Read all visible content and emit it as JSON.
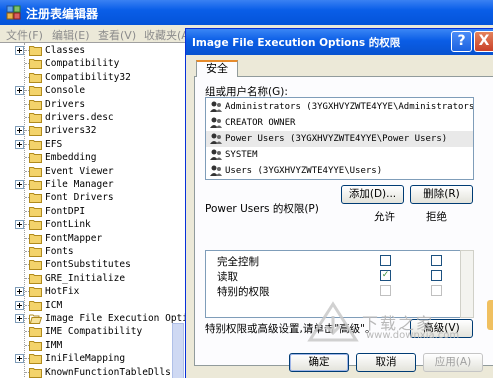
{
  "registry": {
    "title": "注册表编辑器",
    "menu": [
      "文件(F)",
      "编辑(E)",
      "查看(V)",
      "收藏夹(A)"
    ],
    "tree_items": [
      {
        "label": "Classes",
        "expandable": true
      },
      {
        "label": "Compatibility",
        "expandable": false
      },
      {
        "label": "Compatibility32",
        "expandable": false
      },
      {
        "label": "Console",
        "expandable": true
      },
      {
        "label": "Drivers",
        "expandable": false
      },
      {
        "label": "drivers.desc",
        "expandable": false
      },
      {
        "label": "Drivers32",
        "expandable": true
      },
      {
        "label": "EFS",
        "expandable": true
      },
      {
        "label": "Embedding",
        "expandable": false
      },
      {
        "label": "Event Viewer",
        "expandable": false
      },
      {
        "label": "File Manager",
        "expandable": true
      },
      {
        "label": "Font Drivers",
        "expandable": false
      },
      {
        "label": "FontDPI",
        "expandable": false
      },
      {
        "label": "FontLink",
        "expandable": true
      },
      {
        "label": "FontMapper",
        "expandable": false
      },
      {
        "label": "Fonts",
        "expandable": false
      },
      {
        "label": "FontSubstitutes",
        "expandable": false
      },
      {
        "label": "GRE_Initialize",
        "expandable": false
      },
      {
        "label": "HotFix",
        "expandable": true
      },
      {
        "label": "ICM",
        "expandable": true
      },
      {
        "label": "Image File Execution Opti",
        "expandable": true,
        "open": true
      },
      {
        "label": "IME Compatibility",
        "expandable": false
      },
      {
        "label": "IMM",
        "expandable": false
      },
      {
        "label": "IniFileMapping",
        "expandable": true
      },
      {
        "label": "KnownFunctionTableDlls",
        "expandable": false
      }
    ]
  },
  "dialog": {
    "title": "Image File Execution Options 的权限",
    "help_glyph": "?",
    "close_glyph": "X",
    "tab_label": "安全",
    "users_label": "组或用户名称(G):",
    "users": [
      {
        "name": "Administrators (3YGXHVYZWTE4YYE\\Administrators)",
        "selected": false
      },
      {
        "name": "CREATOR OWNER",
        "selected": false
      },
      {
        "name": "Power Users (3YGXHVYZWTE4YYE\\Power Users)",
        "selected": true
      },
      {
        "name": "SYSTEM",
        "selected": false
      },
      {
        "name": "Users (3YGXHVYZWTE4YYE\\Users)",
        "selected": false
      }
    ],
    "add_button": "添加(D)...",
    "remove_button": "删除(R)",
    "perm_label": "Power Users 的权限(P)",
    "allow_header": "允许",
    "deny_header": "拒绝",
    "permissions": [
      {
        "name": "完全控制",
        "allow": false,
        "deny": false,
        "enabled": true
      },
      {
        "name": "读取",
        "allow": true,
        "deny": false,
        "enabled": true
      },
      {
        "name": "特别的权限",
        "allow": false,
        "deny": false,
        "enabled": false
      }
    ],
    "advanced_text": "特别权限或高级设置,请单击\"高级\"。",
    "advanced_button": "高级(V)",
    "ok_button": "确定",
    "cancel_button": "取消",
    "apply_button": "应用(A)"
  },
  "watermark": {
    "text": "下载之家",
    "url": "www.downxia.com"
  },
  "colors": {
    "titlebar_blue": "#0a5ee8",
    "dialog_bg": "#ece9d8",
    "folder_yellow": "#f3d36b",
    "check_green": "#3c8f3c"
  }
}
